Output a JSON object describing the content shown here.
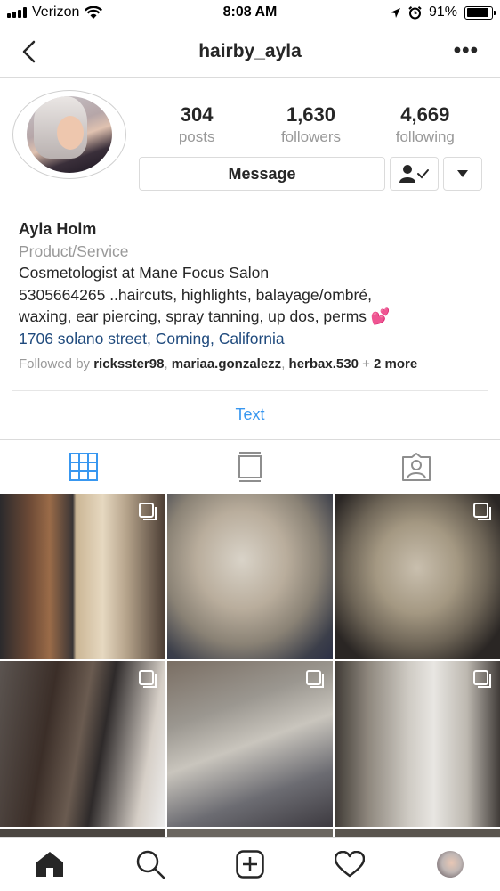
{
  "status_bar": {
    "carrier": "Verizon",
    "time": "8:08 AM",
    "battery_percent": "91%",
    "battery_level": 0.91,
    "icons": [
      "signal-icon",
      "wifi-icon",
      "location-icon",
      "alarm-icon",
      "battery-icon"
    ]
  },
  "nav": {
    "title": "hairby_ayla",
    "more_label": "•••"
  },
  "profile": {
    "stats": [
      {
        "value": "304",
        "label": "posts"
      },
      {
        "value": "1,630",
        "label": "followers"
      },
      {
        "value": "4,669",
        "label": "following"
      }
    ],
    "message_button": "Message",
    "name": "Ayla Holm",
    "category": "Product/Service",
    "bio_line1": "Cosmetologist at Mane Focus Salon",
    "bio_line2": "5305664265 ..haircuts, highlights, balayage/ombré,",
    "bio_line3": "waxing, ear piercing, spray tanning, up dos, perms 💕",
    "address": "1706 solano street, Corning, California",
    "followed_by_prefix": "Followed by",
    "followed_by_users": [
      "ricksster98",
      "mariaa.gonzalezz",
      "herbax.530"
    ],
    "followed_by_more": "2 more"
  },
  "actions": {
    "text_button": "Text"
  },
  "colors": {
    "accent_blue": "#3897f0",
    "link_blue": "#1f4a7d",
    "muted": "#999999",
    "border": "#dbdbdb"
  },
  "tabs": [
    "grid-icon",
    "feed-icon",
    "tagged-icon"
  ],
  "bottom_nav": [
    "home-icon",
    "search-icon",
    "new-post-icon",
    "activity-icon",
    "profile-avatar"
  ]
}
